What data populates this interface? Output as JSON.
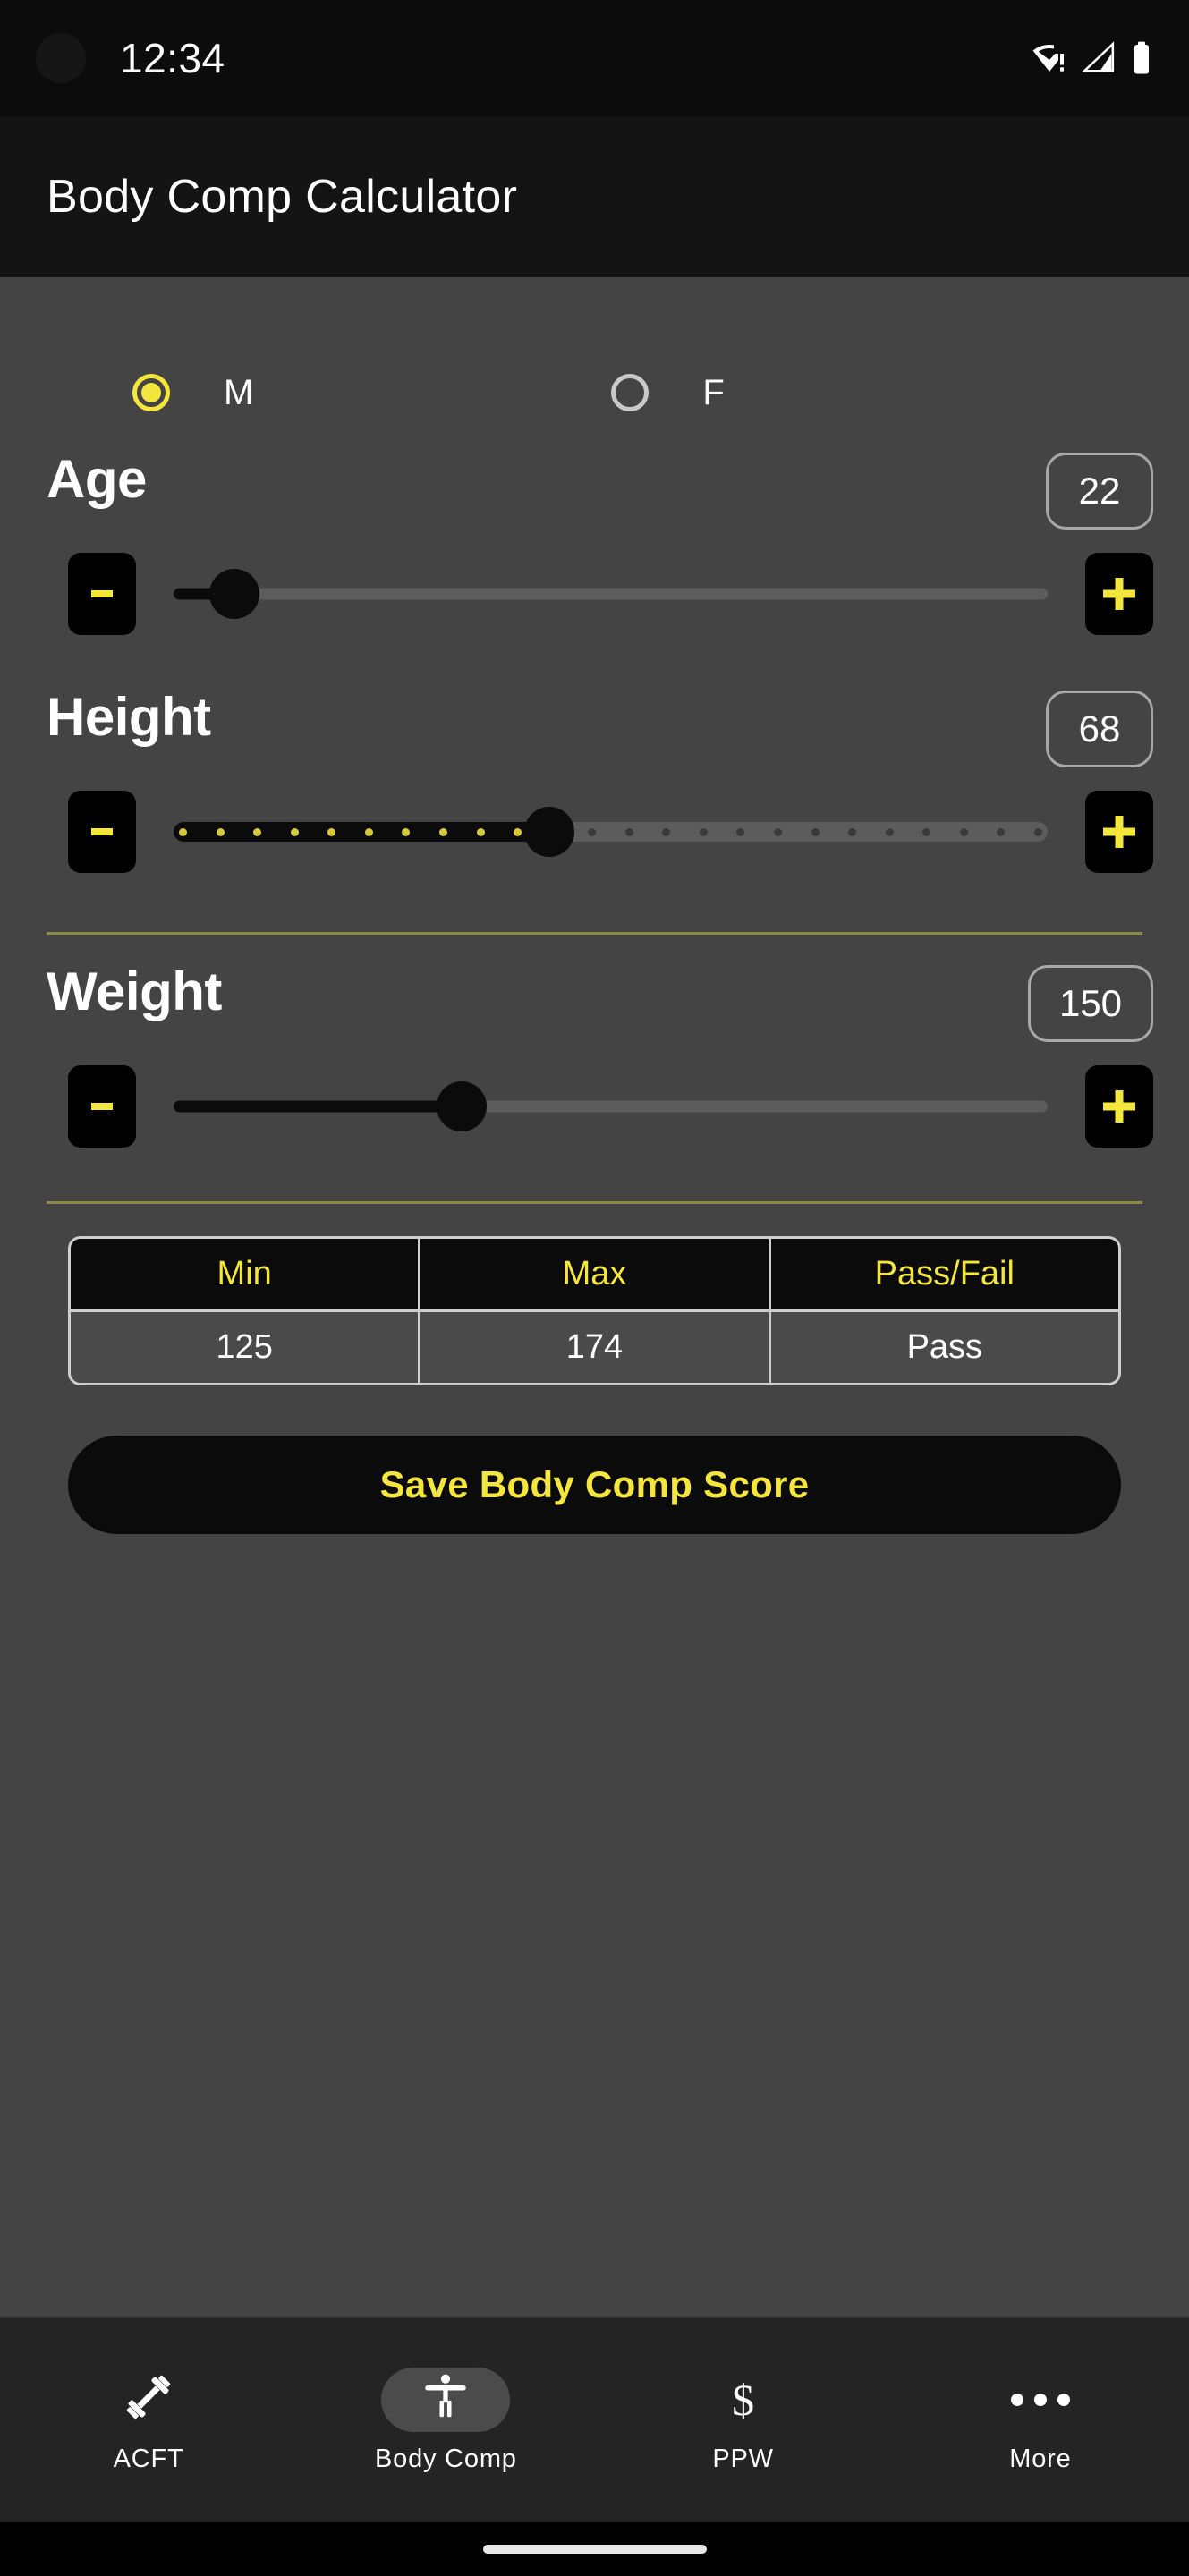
{
  "status_bar": {
    "time": "12:34",
    "icons": [
      "wifi-warning-icon",
      "cellular-signal-icon",
      "battery-full-icon"
    ]
  },
  "app_bar": {
    "title": "Body Comp Calculator"
  },
  "gender": {
    "selected": "M",
    "options": [
      {
        "label": "M",
        "value": "M",
        "selected": true
      },
      {
        "label": "F",
        "value": "F",
        "selected": false
      }
    ]
  },
  "fields": [
    {
      "label": "Age",
      "value": "22",
      "decrement_label": "-",
      "increment_label": "+",
      "slider": {
        "percent": 7,
        "ticked": false
      }
    },
    {
      "label": "Height",
      "value": "68",
      "decrement_label": "-",
      "increment_label": "+",
      "slider": {
        "percent": 43,
        "ticked": true,
        "tick_count": 24,
        "active_ticks": 10
      }
    },
    {
      "label": "Weight",
      "value": "150",
      "decrement_label": "-",
      "increment_label": "+",
      "slider": {
        "percent": 33,
        "ticked": false
      }
    }
  ],
  "result_table": {
    "headers": [
      "Min",
      "Max",
      "Pass/Fail"
    ],
    "rows": [
      [
        "125",
        "174",
        "Pass"
      ]
    ]
  },
  "save_button": {
    "label": "Save Body Comp Score"
  },
  "bottom_nav": {
    "items": [
      {
        "label": "ACFT",
        "icon": "dumbbell-icon",
        "active": false
      },
      {
        "label": "Body Comp",
        "icon": "accessibility-person-icon",
        "active": true
      },
      {
        "label": "PPW",
        "icon": "dollar-sign-icon",
        "active": false
      },
      {
        "label": "More",
        "icon": "more-horizontal-icon",
        "active": false
      }
    ]
  },
  "colors": {
    "accent_yellow": "#f5e63d",
    "background": "#444444",
    "app_bar": "#141414",
    "nav_background": "#242424"
  }
}
